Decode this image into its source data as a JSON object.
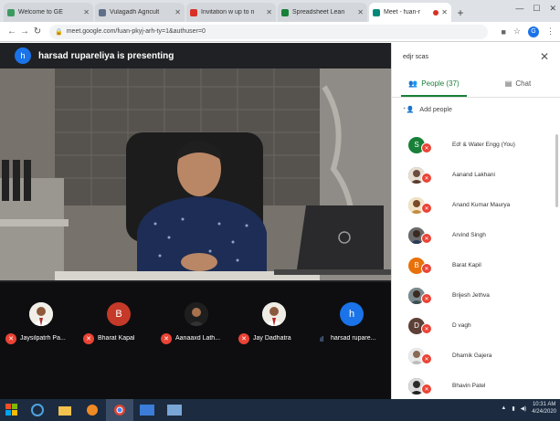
{
  "browser": {
    "tabs": [
      {
        "label": "Welcome to GE",
        "favicon_color": "#3c9a5f"
      },
      {
        "label": "Vulagadh Agricult",
        "favicon_color": "#5f6f8a"
      },
      {
        "label": "Invitation w up to n",
        "favicon_color": "#d93025"
      },
      {
        "label": "Spreadsheet Lean",
        "favicon_color": "#188038"
      },
      {
        "label": "Meet - fuan-r",
        "favicon_color": "#00897b",
        "active": true
      }
    ],
    "url": "meet.google.com/fuan-pkyj-arh-ty=1&authuser=0",
    "profile_initial": "G"
  },
  "meet": {
    "presenter_initial": "h",
    "presenter_text": "harsad rupareliya is presenting",
    "tiles": [
      {
        "name": "Jaysilpatrh Pa...",
        "muted": true
      },
      {
        "name": "Bharat Kapal",
        "muted": true,
        "initial": "B",
        "color": "#c53929"
      },
      {
        "name": "Aanaaxd Lath...",
        "muted": true
      },
      {
        "name": "Jay Dadhatra",
        "muted": true
      },
      {
        "name": "harsad rupare...",
        "muted": false,
        "initial": "h",
        "color": "#1a73e8"
      }
    ]
  },
  "panel": {
    "title": "edjr scas",
    "tab_people": "People (37)",
    "tab_chat": "Chat",
    "add_people": "Add people",
    "participants": [
      {
        "name": "Ed! & Water Engg (You)",
        "initial": "S",
        "color": "#188038"
      },
      {
        "name": "Aanand Lakhani",
        "initial": "",
        "color": "#6d4c41"
      },
      {
        "name": "Anand Kumar Maurya",
        "initial": "",
        "color": "#c48b3f"
      },
      {
        "name": "Arvind Singh",
        "initial": "",
        "color": "#555"
      },
      {
        "name": "Barat Kapil",
        "initial": "B",
        "color": "#e8710a"
      },
      {
        "name": "Brijesh Jethva",
        "initial": "",
        "color": "#4e5a5e"
      },
      {
        "name": "D vagh",
        "initial": "D",
        "color": "#5d4037"
      },
      {
        "name": "Dhamik Gajera",
        "initial": "",
        "color": "#9e9e9e"
      },
      {
        "name": "Bhavin Patel",
        "initial": "",
        "color": "#333"
      }
    ]
  },
  "taskbar": {
    "time": "10:31 AM",
    "date": "4/24/2020"
  }
}
